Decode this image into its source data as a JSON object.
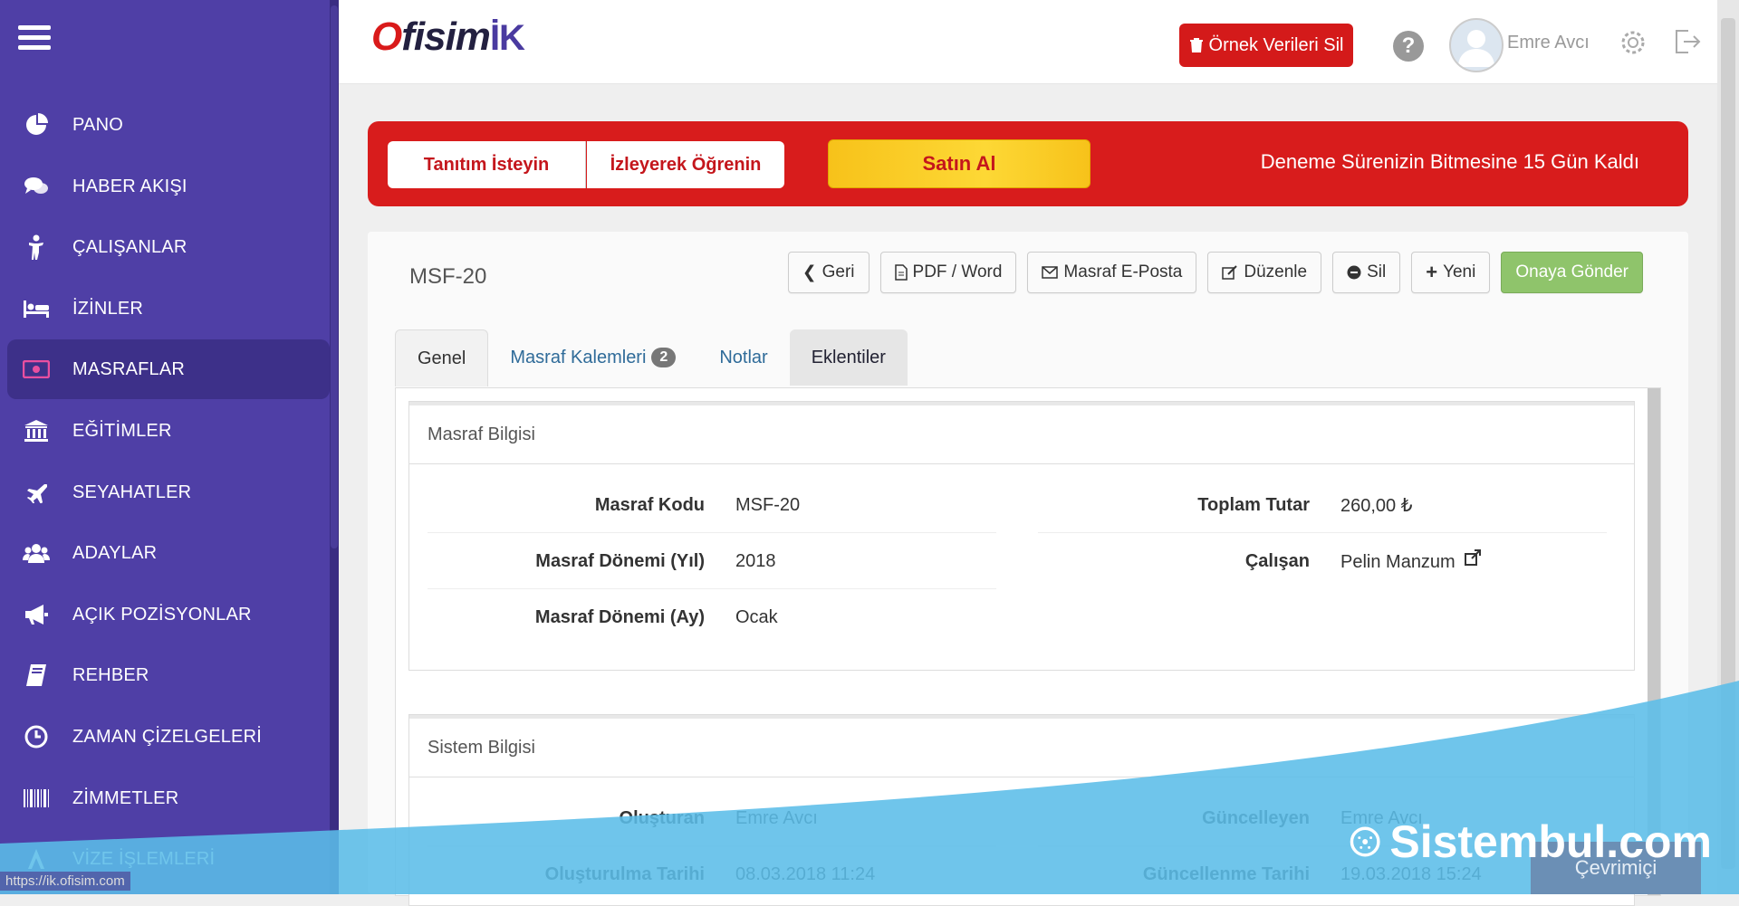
{
  "sidebar": {
    "items": [
      {
        "label": "PANO",
        "icon": "pie-chart-icon"
      },
      {
        "label": "HABER AKIŞI",
        "icon": "comments-icon"
      },
      {
        "label": "ÇALIŞANLAR",
        "icon": "person-icon"
      },
      {
        "label": "İZİNLER",
        "icon": "bed-icon"
      },
      {
        "label": "MASRAFLAR",
        "icon": "money-icon"
      },
      {
        "label": "EĞİTİMLER",
        "icon": "institution-icon"
      },
      {
        "label": "SEYAHATLER",
        "icon": "plane-icon"
      },
      {
        "label": "ADAYLAR",
        "icon": "users-icon"
      },
      {
        "label": "AÇIK POZİSYONLAR",
        "icon": "bullhorn-icon"
      },
      {
        "label": "REHBER",
        "icon": "book-icon"
      },
      {
        "label": "ZAMAN ÇİZELGELERİ",
        "icon": "clock-icon"
      },
      {
        "label": "ZİMMETLER",
        "icon": "barcode-icon"
      },
      {
        "label": "VİZE İŞLEMLERİ",
        "icon": "passport-icon"
      }
    ],
    "active_index": 4
  },
  "header": {
    "logo_o": "O",
    "logo_main": "fisim",
    "logo_ik": "İK",
    "delete_sample_label": "Örnek Verileri Sil",
    "user_name": "Emre Avcı"
  },
  "trial": {
    "demo_label": "Tanıtım İsteyin",
    "learn_label": "İzleyerek Öğrenin",
    "buy_label": "Satın Al",
    "remaining_text": "Deneme Sürenizin Bitmesine 15 Gün Kaldı"
  },
  "document": {
    "title": "MSF-20",
    "toolbar": {
      "back": "Geri",
      "pdf": "PDF / Word",
      "email": "Masraf E-Posta",
      "edit": "Düzenle",
      "delete": "Sil",
      "new": "Yeni",
      "submit": "Onaya Gönder"
    },
    "tabs": {
      "general": "Genel",
      "items": "Masraf Kalemleri",
      "items_count": "2",
      "notes": "Notlar",
      "attachments": "Eklentiler"
    }
  },
  "expense_info": {
    "title": "Masraf Bilgisi",
    "code_label": "Masraf Kodu",
    "code_value": "MSF-20",
    "year_label": "Masraf Dönemi (Yıl)",
    "year_value": "2018",
    "month_label": "Masraf Dönemi (Ay)",
    "month_value": "Ocak",
    "total_label": "Toplam Tutar",
    "total_value": "260,00 ₺",
    "employee_label": "Çalışan",
    "employee_value": "Pelin Manzum"
  },
  "system_info": {
    "title": "Sistem Bilgisi",
    "created_by_label": "Oluşturan",
    "created_by_value": "Emre Avcı",
    "updated_by_label": "Güncelleyen",
    "updated_by_value": "Emre Avcı",
    "created_at_label": "Oluşturulma Tarihi",
    "created_at_value": "08.03.2018 11:24",
    "updated_at_label": "Güncellenme Tarihi",
    "updated_at_value": "19.03.2018 15:24"
  },
  "status_url": "https://ik.ofisim.com",
  "watermark_text": "Sistembul.com",
  "online_label": "Çevrimiçi",
  "colors": {
    "sidebar": "#4f3fa6",
    "brand_red": "#d81c1c",
    "buy_yellow": "#fdd835",
    "approve_green": "#8fc46b",
    "link_blue": "#2f6b99",
    "wave_blue": "#5bbde8"
  }
}
